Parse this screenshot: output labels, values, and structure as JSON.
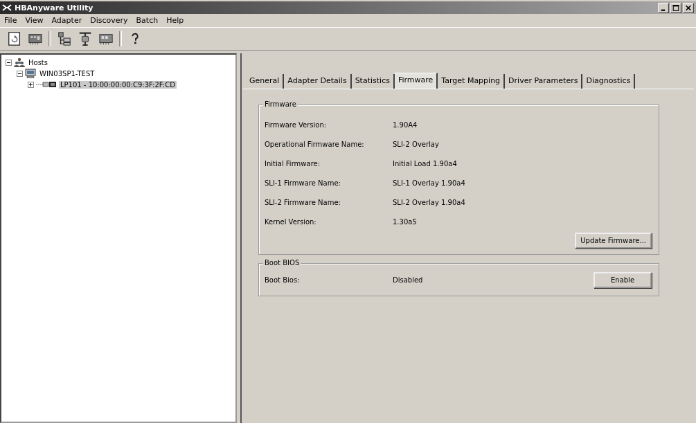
{
  "window": {
    "title": "HBAnyware Utility"
  },
  "menu": [
    "File",
    "View",
    "Adapter",
    "Discovery",
    "Batch",
    "Help"
  ],
  "tree": [
    {
      "label": "Hosts",
      "kind": "hosts",
      "expanded": true,
      "selected": false,
      "children": [
        {
          "label": "WIN03SP1-TEST",
          "kind": "host",
          "expanded": true,
          "selected": false,
          "children": [
            {
              "label": "LP101 - 10:00:00:00:C9:3F:2F:CD",
              "kind": "adapter",
              "expanded": false,
              "selected": true
            }
          ]
        }
      ]
    }
  ],
  "tabs": [
    {
      "label": "General",
      "selected": false
    },
    {
      "label": "Adapter Details",
      "selected": false
    },
    {
      "label": "Statistics",
      "selected": false
    },
    {
      "label": "Firmware",
      "selected": true
    },
    {
      "label": "Target Mapping",
      "selected": false
    },
    {
      "label": "Driver Parameters",
      "selected": false
    },
    {
      "label": "Diagnostics",
      "selected": false
    }
  ],
  "firmware": {
    "legend": "Firmware",
    "rows": [
      {
        "label": "Firmware Version:",
        "value": "1.90A4"
      },
      {
        "label": "Operational Firmware Name:",
        "value": "SLI-2 Overlay"
      },
      {
        "label": "Initial Firmware:",
        "value": "Initial Load 1.90a4"
      },
      {
        "label": "SLI-1 Firmware Name:",
        "value": "SLI-1 Overlay 1.90a4"
      },
      {
        "label": "SLI-2 Firmware Name:",
        "value": "SLI-2 Overlay 1.90a4"
      },
      {
        "label": "Kernel Version:",
        "value": "1.30a5"
      }
    ],
    "button": "Update Firmware..."
  },
  "boot_bios": {
    "legend": "Boot BIOS",
    "label": "Boot Bios:",
    "value": "Disabled",
    "button": "Enable"
  }
}
